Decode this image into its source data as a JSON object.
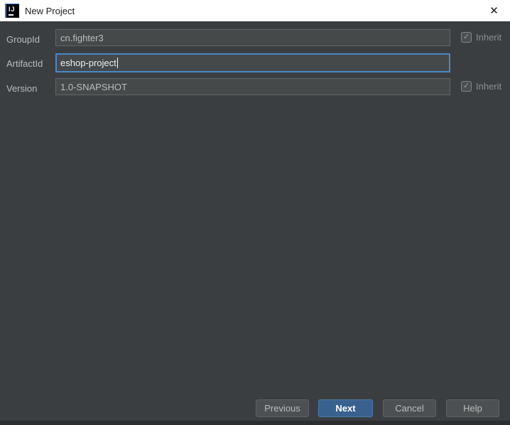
{
  "window": {
    "title": "New Project"
  },
  "glyphs": {
    "app_icon_letters": "IJ",
    "close": "✕",
    "check": "✓"
  },
  "form": {
    "rows": [
      {
        "label": "GroupId",
        "value": "cn.fighter3",
        "inherit": {
          "label": "Inherit",
          "checked": true
        }
      },
      {
        "label": "ArtifactId",
        "value": "eshop-project",
        "focused": true
      },
      {
        "label": "Version",
        "value": "1.0-SNAPSHOT",
        "inherit": {
          "label": "Inherit",
          "checked": true
        }
      }
    ]
  },
  "footer": {
    "buttons": [
      {
        "label": "Previous"
      },
      {
        "label": "Next",
        "default": true
      },
      {
        "label": "Cancel"
      },
      {
        "label": "Help"
      }
    ]
  },
  "colors": {
    "titlebar_bg": "#ffffff",
    "body_bg": "#3b3e40",
    "field_bg": "#45494a",
    "field_border": "#646464",
    "focus_border": "#4a88c7",
    "button_bg": "#4c5052",
    "default_button_bg": "#38618f",
    "label_text": "#bbbbbb",
    "disabled_text": "#8c8f91"
  }
}
